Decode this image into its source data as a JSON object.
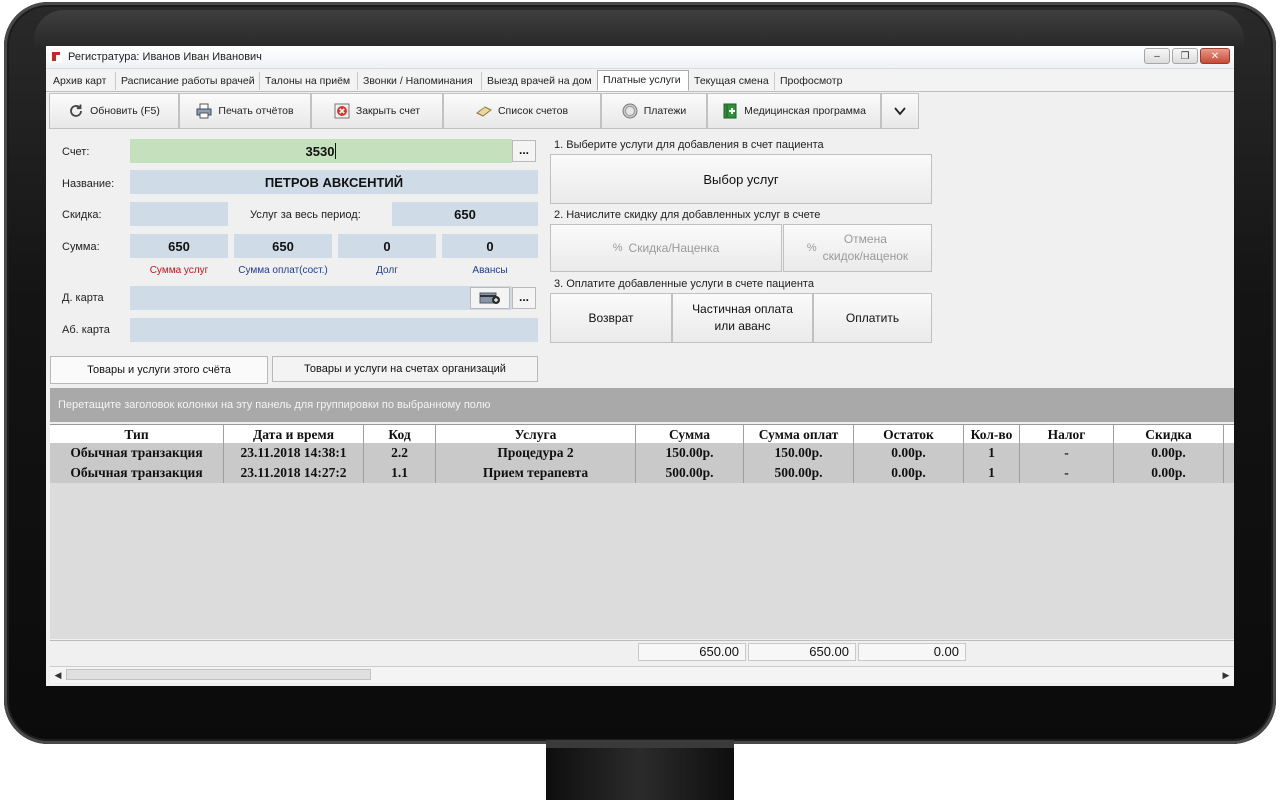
{
  "window": {
    "title": "Регистратура: Иванов Иван Иванович"
  },
  "tabs": [
    {
      "label": "Архив карт"
    },
    {
      "label": "Расписание работы врачей"
    },
    {
      "label": "Талоны на приём"
    },
    {
      "label": "Звонки / Напоминания"
    },
    {
      "label": "Выезд врачей на дом"
    },
    {
      "label": "Платные услуги"
    },
    {
      "label": "Текущая смена"
    },
    {
      "label": "Профосмотр"
    }
  ],
  "active_tab": "Платные услуги",
  "toolbar": {
    "refresh": "Обновить (F5)",
    "print": "Печать отчётов",
    "close_account": "Закрыть счет",
    "accounts_list": "Список счетов",
    "payments": "Платежи",
    "med_program": "Медицинская программа"
  },
  "form": {
    "account_label": "Счет:",
    "account_value": "3530",
    "name_label": "Название:",
    "name_value": "ПЕТРОВ АВКСЕНТИЙ",
    "discount_label": "Скидка:",
    "period_services_label": "Услуг за весь период:",
    "period_services_value": "650",
    "sum_label": "Сумма:",
    "sums": [
      "650",
      "650",
      "0",
      "0"
    ],
    "sum_captions": [
      "Сумма услуг",
      "Сумма оплат(сост.)",
      "Долг",
      "Авансы"
    ],
    "dcard_label": "Д. карта",
    "abcard_label": "Аб. карта",
    "ellipsis": "..."
  },
  "steps": {
    "step1": "1. Выберите услуги для добавления в счет пациента",
    "select_services": "Выбор услуг",
    "step2": "2. Начислите скидку для добавленных услуг в счете",
    "discount_markup": "Скидка/Наценка",
    "cancel_discount_line1": "Отмена",
    "cancel_discount_line2": "скидок/наценок",
    "step3": "3. Оплатите добавленные услуги в счете пациента",
    "refund": "Возврат",
    "partial_line1": "Частичная оплата",
    "partial_line2": "или аванс",
    "pay": "Оплатить"
  },
  "subtabs": {
    "this_account": "Товары и услуги этого счёта",
    "org_accounts": "Товары и услуги на счетах организаций"
  },
  "grid": {
    "group_hint": "Перетащите заголовок колонки на эту панель для группировки по выбранному полю",
    "columns": [
      "Тип",
      "Дата и время",
      "Код",
      "Услуга",
      "Сумма",
      "Сумма оплат",
      "Остаток",
      "Кол-во",
      "Налог",
      "Скидка"
    ],
    "rows": [
      [
        "Обычная транзакция",
        "23.11.2018 14:38:1",
        "2.2",
        "Процедура 2",
        "150.00р.",
        "150.00р.",
        "0.00р.",
        "1",
        "-",
        "0.00р."
      ],
      [
        "Обычная транзакция",
        "23.11.2018 14:27:2",
        "1.1",
        "Прием терапевта",
        "500.00р.",
        "500.00р.",
        "0.00р.",
        "1",
        "-",
        "0.00р."
      ]
    ],
    "totals": [
      "650.00",
      "650.00",
      "0.00"
    ]
  },
  "colors": {
    "account_field": "#c4e0bd",
    "field_bg": "#cfdbe6",
    "caption_red": "#c0161b",
    "caption_blue": "#1f3d8f",
    "grid_row": "#c9c9c9",
    "group_panel": "#a9a9a9"
  }
}
